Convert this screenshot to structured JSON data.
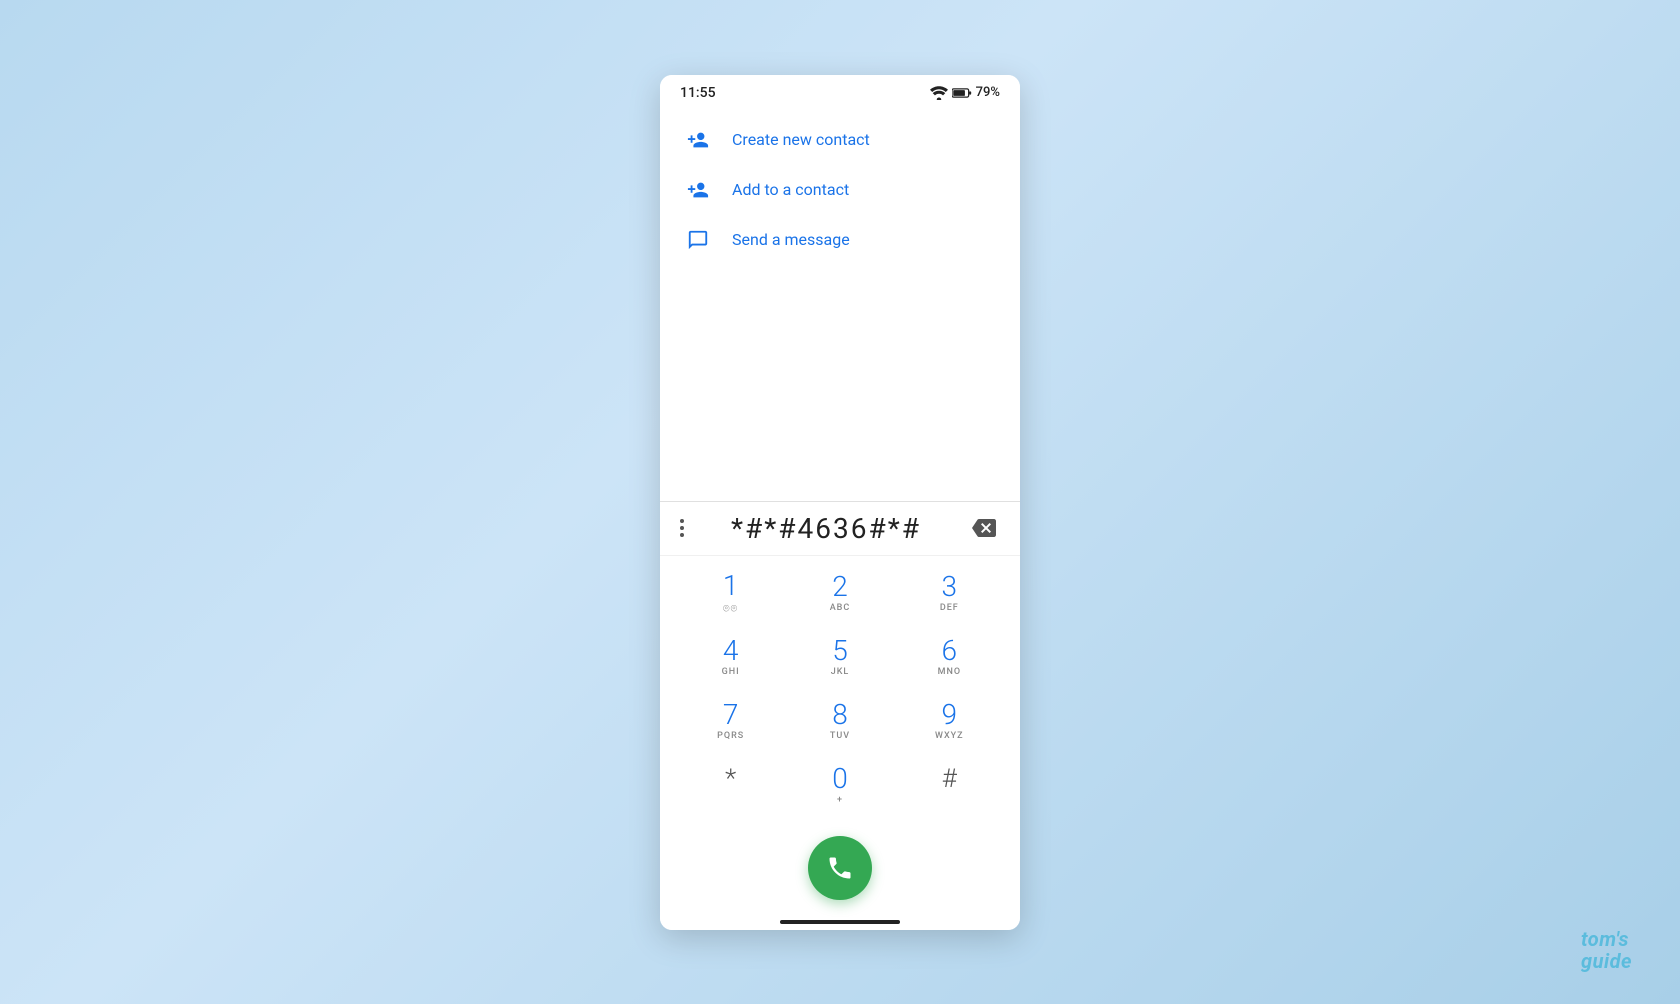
{
  "status": {
    "time": "11:55",
    "battery": "79%",
    "wifi": "▾"
  },
  "menu": {
    "items": [
      {
        "id": "create-new-contact",
        "label": "Create new contact",
        "icon": "person-add"
      },
      {
        "id": "add-to-contact",
        "label": "Add to a contact",
        "icon": "person-add"
      },
      {
        "id": "send-message",
        "label": "Send a message",
        "icon": "message"
      }
    ]
  },
  "dialer": {
    "input": "*#*#4636#*#",
    "keys": [
      [
        {
          "number": "1",
          "letters": "◦◦"
        },
        {
          "number": "2",
          "letters": "ABC"
        },
        {
          "number": "3",
          "letters": "DEF"
        }
      ],
      [
        {
          "number": "4",
          "letters": "GHI"
        },
        {
          "number": "5",
          "letters": "JKL"
        },
        {
          "number": "6",
          "letters": "MNO"
        }
      ],
      [
        {
          "number": "7",
          "letters": "PQRS"
        },
        {
          "number": "8",
          "letters": "TUV"
        },
        {
          "number": "9",
          "letters": "WXYZ"
        }
      ],
      [
        {
          "number": "*",
          "letters": "",
          "type": "symbol"
        },
        {
          "number": "0",
          "letters": "+",
          "type": "zero"
        },
        {
          "number": "#",
          "letters": "",
          "type": "symbol"
        }
      ]
    ],
    "call_button_aria": "Call"
  },
  "watermark": {
    "line1": "tom's",
    "line2": "guide"
  }
}
